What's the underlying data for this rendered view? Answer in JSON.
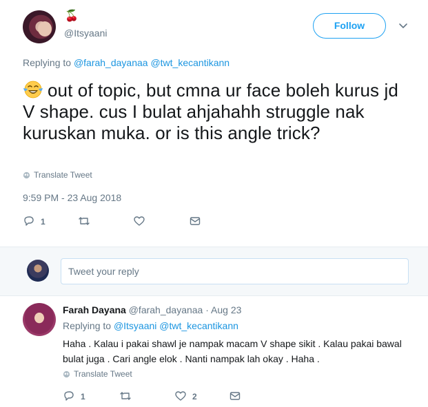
{
  "main_tweet": {
    "display_name": "🍒",
    "handle": "@Itsyaani",
    "follow_label": "Follow",
    "replying_prefix": "Replying to",
    "replying_users": [
      "@farah_dayanaa",
      "@twt_kecantikann"
    ],
    "text": "out of topic,  but cmna ur face boleh kurus jd V shape.  cus I bulat ahjahahh struggle nak kuruskan muka. or is this angle trick?",
    "emoji": "face-with-tears-of-joy",
    "translate_label": "Translate Tweet",
    "timestamp": "9:59 PM - 23 Aug 2018",
    "actions": {
      "reply_count": "1",
      "retweet_count": "",
      "like_count": ""
    }
  },
  "composer": {
    "placeholder": "Tweet your reply"
  },
  "reply_tweet": {
    "name": "Farah Dayana",
    "handle": "@farah_dayanaa",
    "separator": "·",
    "date": "Aug 23",
    "replying_prefix": "Replying to",
    "replying_users": [
      "@Itsyaani",
      "@twt_kecantikann"
    ],
    "text": "Haha . Kalau i pakai shawl je nampak macam V shape sikit . Kalau pakai bawal bulat juga . Cari angle elok . Nanti nampak lah okay . Haha .",
    "translate_label": "Translate Tweet",
    "actions": {
      "reply_count": "1",
      "retweet_count": "",
      "like_count": "2"
    }
  },
  "colors": {
    "link": "#1b95e0",
    "muted": "#657786",
    "text": "#14171a",
    "follow_border": "#1da1f2"
  },
  "icons": [
    "cherry-emoji",
    "caret-down-icon",
    "globe-icon",
    "reply-icon",
    "retweet-icon",
    "like-icon",
    "message-icon",
    "face-with-tears-of-joy-emoji"
  ]
}
